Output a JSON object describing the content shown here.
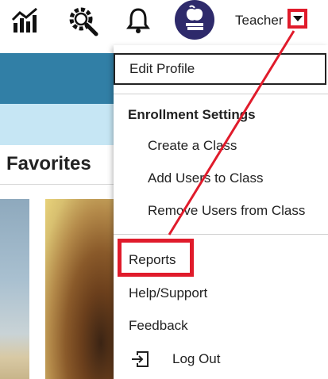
{
  "header": {
    "icons": [
      "chart-bars-icon",
      "gear-search-icon",
      "bell-icon",
      "apple-books-icon"
    ],
    "username": "Teacher"
  },
  "page": {
    "favorites_title": "Favorites"
  },
  "user_menu": {
    "edit_profile": "Edit Profile",
    "enrollment_heading": "Enrollment Settings",
    "create_class": "Create a Class",
    "add_users": "Add Users to Class",
    "remove_users": "Remove Users from Class",
    "reports": "Reports",
    "help_support": "Help/Support",
    "feedback": "Feedback",
    "log_out": "Log Out"
  },
  "colors": {
    "banner": "#317fa6",
    "light_band": "#c6e6f4",
    "avatar": "#2e2a6b",
    "highlight": "#e01b2b"
  }
}
